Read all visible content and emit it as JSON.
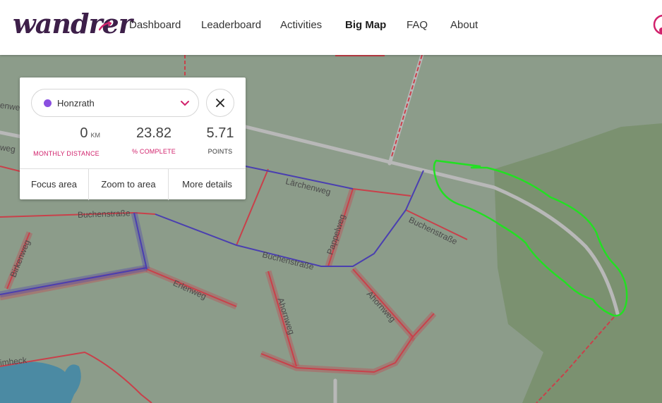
{
  "brand": {
    "logo_text": "wandrer",
    "color": "#3d1f49",
    "accent": "#d1226c"
  },
  "nav": {
    "items": [
      {
        "label": "Dashboard"
      },
      {
        "label": "Leaderboard"
      },
      {
        "label": "Activities"
      },
      {
        "label": "Big Map",
        "active": true
      },
      {
        "label": "FAQ"
      },
      {
        "label": "About"
      }
    ]
  },
  "panel": {
    "area": {
      "name": "Honzrath",
      "dot_color": "#8a4fe0"
    },
    "stats": {
      "distance": {
        "value": "0",
        "unit": "KM",
        "label": "MONTHLY DISTANCE"
      },
      "complete": {
        "value": "23.82",
        "label": "% COMPLETE"
      },
      "points": {
        "value": "5.71",
        "label": "POINTS"
      }
    },
    "actions": {
      "focus": "Focus area",
      "zoom": "Zoom to area",
      "more": "More details"
    }
  },
  "map": {
    "streets": {
      "larchenweg": "Lärchenweg",
      "buchenstrasse_1": "Buchenstraße",
      "buchenstrasse_2": "Buchenstraße",
      "buchenstrasse_3": "Buchenstraße",
      "pappelweg": "Pappelweg",
      "ahornweg_1": "Ahornweg",
      "ahornweg_2": "Ahornweg",
      "erlenweg": "Erlenweg",
      "birkenweg": "Birkenweg",
      "dimheck": "imheck",
      "left_top": "enwe",
      "left_mid": "weg"
    },
    "colors": {
      "untraveled": "#c9404a",
      "traveled": "#4a3fb0",
      "annotation": "#22e022"
    }
  }
}
